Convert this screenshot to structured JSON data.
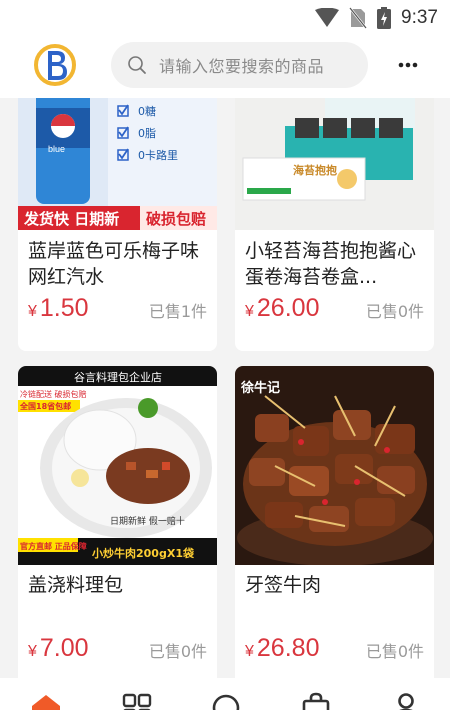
{
  "status_bar": {
    "time": "9:37"
  },
  "header": {
    "search_placeholder": "请输入您要搜索的商品"
  },
  "products": [
    {
      "title": "蓝岸蓝色可乐梅子味网红汽水",
      "currency": "¥",
      "price": "1.50",
      "sold": "已售1件",
      "image": {
        "check_items": [
          "0糖",
          "0脂",
          "0卡路里"
        ],
        "banner_left": "发货快 日期新",
        "banner_right": "破损包赔"
      }
    },
    {
      "title": "小轻苔海苔抱抱酱心蛋卷海苔卷盒...",
      "currency": "¥",
      "price": "26.00",
      "sold": "已售0件",
      "image": {
        "box_label": "海苔抱抱"
      }
    },
    {
      "title": "盖浇料理包",
      "currency": "¥",
      "price": "7.00",
      "sold": "已售0件",
      "image": {
        "shop_banner": "谷言料理包企业店",
        "badge_1": "冷链配送 破损包赔",
        "badge_2": "全国18省包邮",
        "fresh_text": "日期新鲜 假一赔十",
        "bottom_left": "官方直邮 正品保障",
        "bottom_right": "小炒牛肉200gX1袋"
      }
    },
    {
      "title": "牙签牛肉",
      "currency": "¥",
      "price": "26.80",
      "sold": "已售0件",
      "image": {
        "brand_text": "徐牛记"
      }
    }
  ],
  "colors": {
    "accent": "#d9363e",
    "tab_active": "#f05a28"
  },
  "icons": [
    "signal-icon",
    "sim-icon",
    "battery-icon",
    "search-icon",
    "more-icon",
    "home-icon",
    "category-icon",
    "discover-icon",
    "cart-icon",
    "profile-icon"
  ]
}
